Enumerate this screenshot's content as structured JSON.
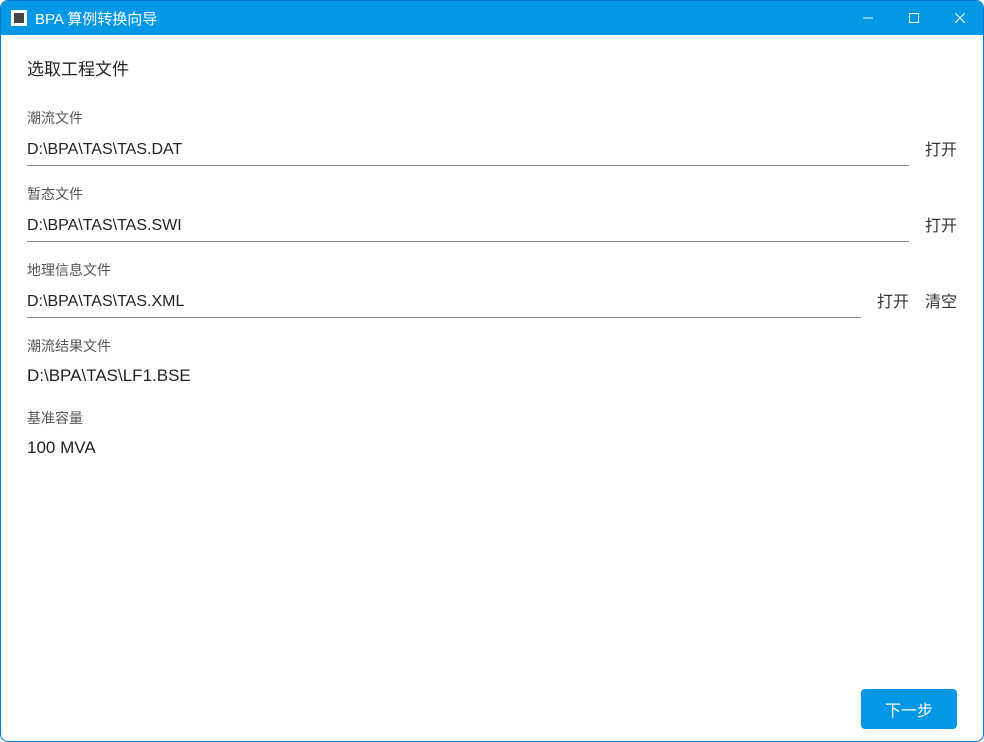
{
  "titlebar": {
    "title": "BPA 算例转换向导"
  },
  "section_title": "选取工程文件",
  "fields": {
    "power_flow": {
      "label": "潮流文件",
      "value": "D:\\BPA\\TAS\\TAS.DAT",
      "open": "打开"
    },
    "transient": {
      "label": "暂态文件",
      "value": "D:\\BPA\\TAS\\TAS.SWI",
      "open": "打开"
    },
    "geo": {
      "label": "地理信息文件",
      "value": "D:\\BPA\\TAS\\TAS.XML",
      "open": "打开",
      "clear": "清空"
    },
    "result": {
      "label": "潮流结果文件",
      "value": "D:\\BPA\\TAS\\LF1.BSE"
    },
    "base": {
      "label": "基准容量",
      "value": "100 MVA"
    }
  },
  "footer": {
    "next": "下一步"
  }
}
